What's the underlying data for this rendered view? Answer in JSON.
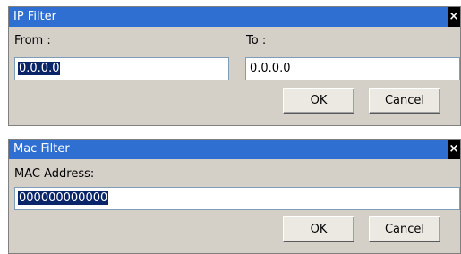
{
  "ip_filter": {
    "title": "IP Filter",
    "close_glyph": "×",
    "from_label": "From :",
    "from_value": "0.0.0.0",
    "to_label": "To :",
    "to_value": "0.0.0.0",
    "ok_label": "OK",
    "cancel_label": "Cancel"
  },
  "mac_filter": {
    "title": "Mac Filter",
    "close_glyph": "×",
    "mac_label": "MAC Address:",
    "mac_value": "000000000000",
    "ok_label": "OK",
    "cancel_label": "Cancel"
  },
  "colors": {
    "titlebar": "#2f6fd2",
    "dialog_bg": "#d4d0c8",
    "selection": "#0a246a"
  },
  "icons": {
    "close": "close-icon"
  }
}
